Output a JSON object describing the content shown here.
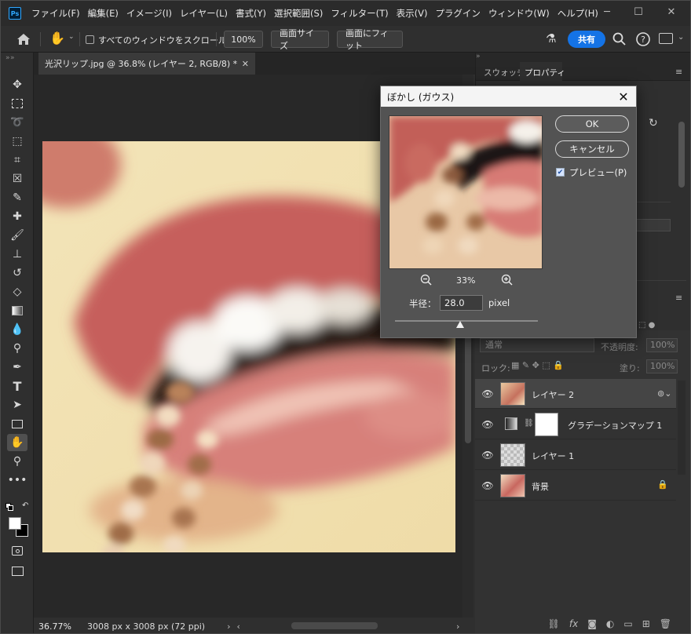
{
  "menubar": {
    "logo": "Ps",
    "items": [
      "ファイル(F)",
      "編集(E)",
      "イメージ(I)",
      "レイヤー(L)",
      "書式(Y)",
      "選択範囲(S)",
      "フィルター(T)",
      "表示(V)",
      "プラグイン",
      "ウィンドウ(W)",
      "ヘルプ(H)"
    ]
  },
  "options": {
    "scroll_all_label": "すべてのウィンドウをスクロール",
    "zoom_value": "100%",
    "fit_screen_label": "画面サイズ",
    "fill_screen_label": "画面にフィット",
    "share_label": "共有"
  },
  "document": {
    "tab_title": "光沢リップ.jpg @ 36.8% (レイヤー 2, RGB/8) *",
    "zoom_status": "36.77%",
    "size_status": "3008 px x 3008 px (72 ppi)"
  },
  "panels": {
    "tabs": [
      "スウォッチ",
      "プロパティ"
    ],
    "blend_mode": "通常",
    "opacity_label": "不透明度:",
    "opacity_value": "100%",
    "lock_label": "ロック:",
    "fill_label": "塗り:",
    "fill_value": "100%"
  },
  "layers": [
    {
      "name": "レイヤー 2",
      "selected": true
    },
    {
      "name": "グラデーションマップ 1",
      "selected": false
    },
    {
      "name": "レイヤー 1",
      "selected": false
    },
    {
      "name": "背景",
      "selected": false
    }
  ],
  "dialog": {
    "title": "ぼかし (ガウス)",
    "ok_label": "OK",
    "cancel_label": "キャンセル",
    "preview_label": "プレビュー(P)",
    "preview_checked": true,
    "zoom": "33%",
    "radius_label": "半径：",
    "radius_value": "28.0",
    "radius_unit": "pixel"
  }
}
